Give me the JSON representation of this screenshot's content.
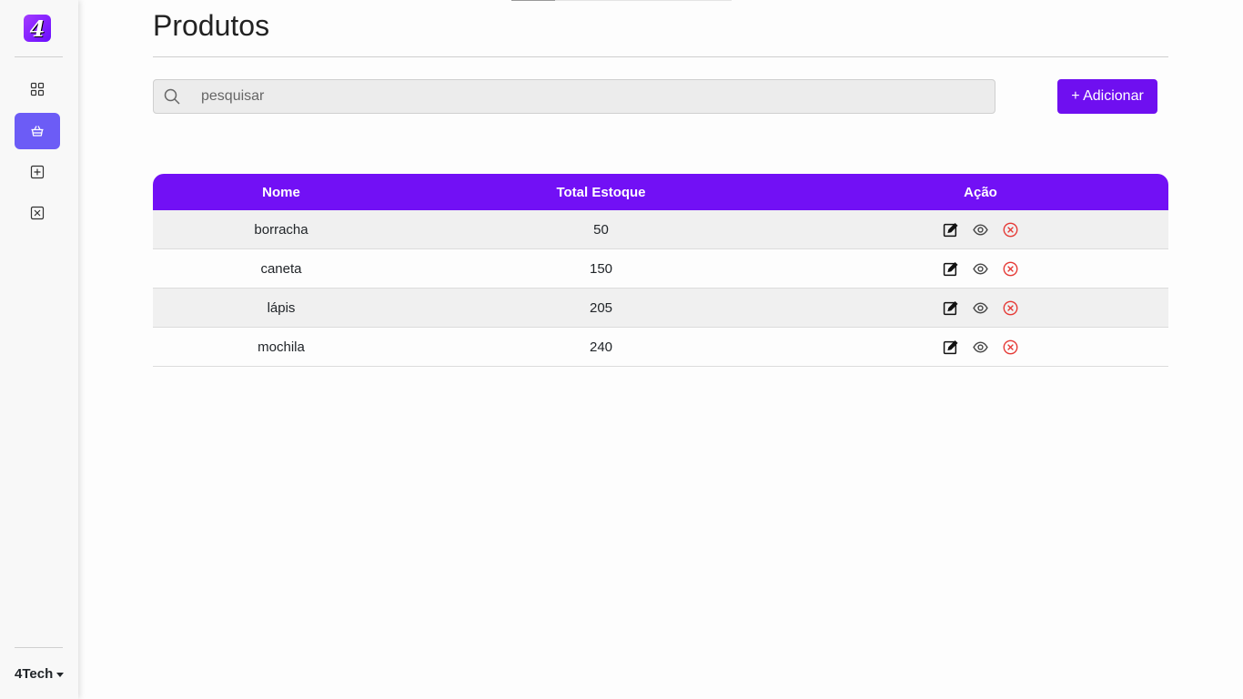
{
  "app": {
    "logo_text": "4",
    "brand": "4Tech"
  },
  "page": {
    "title": "Produtos"
  },
  "search": {
    "placeholder": "pesquisar",
    "value": ""
  },
  "actions": {
    "add_label": "+ Adicionar"
  },
  "colors": {
    "accent": "#7210f5",
    "active_nav": "#6c5cf6",
    "delete": "#e53935"
  },
  "sidebar": {
    "items": [
      {
        "icon": "grid-icon",
        "active": false
      },
      {
        "icon": "basket-icon",
        "active": true
      },
      {
        "icon": "plus-square-icon",
        "active": false
      },
      {
        "icon": "x-square-icon",
        "active": false
      }
    ]
  },
  "table": {
    "headers": [
      "Nome",
      "Total Estoque",
      "Ação"
    ],
    "rows": [
      {
        "name": "borracha",
        "stock": "50"
      },
      {
        "name": "caneta",
        "stock": "150"
      },
      {
        "name": "lápis",
        "stock": "205"
      },
      {
        "name": "mochila",
        "stock": "240"
      }
    ],
    "row_actions": [
      "edit-icon",
      "view-icon",
      "delete-icon"
    ]
  }
}
